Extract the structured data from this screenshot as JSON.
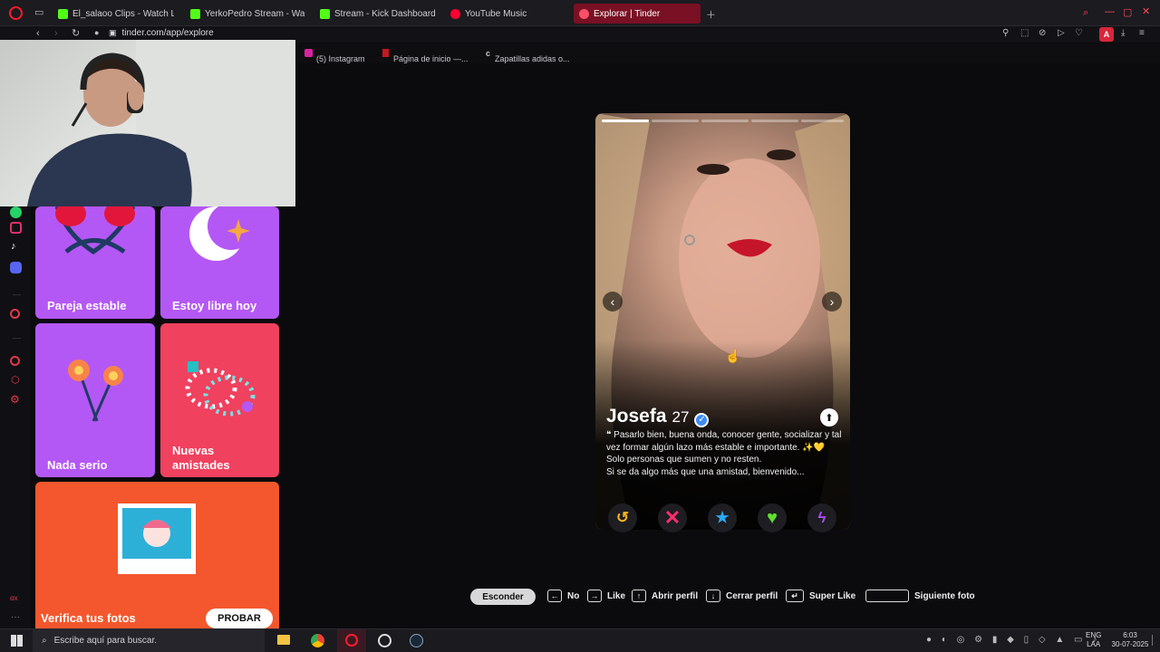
{
  "tabs": [
    {
      "label": "El_salaoo Clips - Watch Li",
      "color": "#53fc18"
    },
    {
      "label": "YerkoPedro Stream - Wa",
      "color": "#53fc18"
    },
    {
      "label": "Stream - Kick Dashboard",
      "color": "#53fc18"
    },
    {
      "label": "YouTube Music",
      "color": "#ff0033"
    },
    {
      "label": "Explorar | Tinder",
      "color": "#fd5068"
    }
  ],
  "address": {
    "url": "tinder.com/app/explore",
    "avatar_letter": "A"
  },
  "bookmarks": [
    "(5) Instagram",
    "Página de inicio —...",
    "Zapatillas adidas o..."
  ],
  "tiles": {
    "pareja": "Pareja estable",
    "libre": "Estoy libre hoy",
    "nada": "Nada serio",
    "nuevas": "Nuevas amistades",
    "verifica": "Verifica tus fotos",
    "probar": "PROBAR"
  },
  "profile": {
    "name": "Josefa",
    "age": "27",
    "bio": "❝ Pasarlo bien, buena onda, conocer gente, socializar y tal vez formar algún lazo más estable e importante. ✨💛 Solo personas que sumen y no resten.",
    "bio2": "Si se da algo más que una amistad, bienvenido..."
  },
  "shortcuts": {
    "hide": "Esconder",
    "no": "No",
    "like": "Like",
    "open": "Abrir perfil",
    "close": "Cerrar perfil",
    "super": "Super Like",
    "next": "Siguiente foto"
  },
  "taskbar": {
    "search": "Escribe aquí para buscar.",
    "lang1": "ENG",
    "lang2": "LAA",
    "time": "6:03",
    "date": "30-07-2025"
  },
  "colors": {
    "accent": "#fd5068",
    "purple": "#b458f5",
    "coral": "#f0415f",
    "orange": "#f4572d"
  }
}
